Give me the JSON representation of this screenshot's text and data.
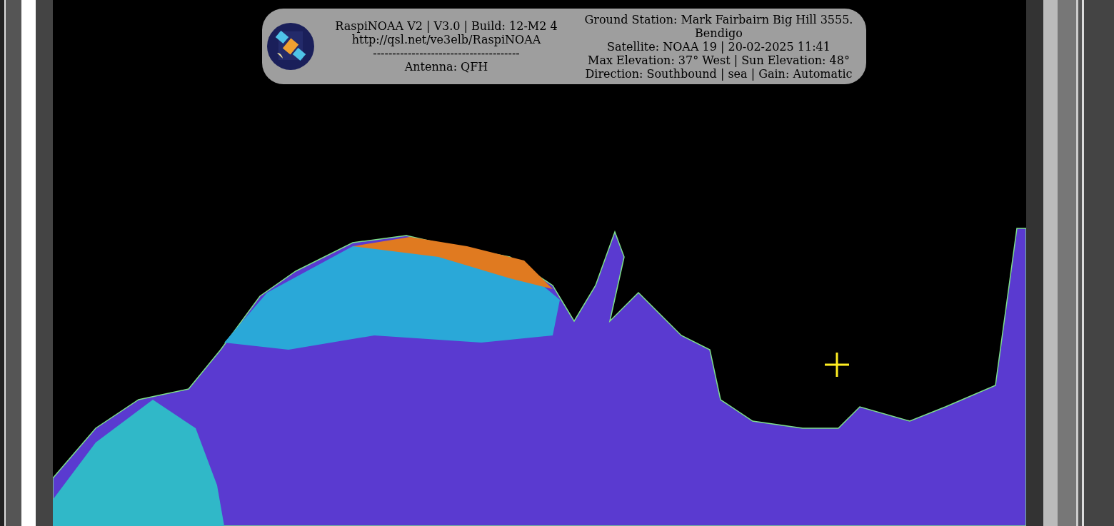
{
  "header": {
    "left_lines": [
      "RaspiNOAA V2 | V3.0 | Build: 12-M2 4",
      "http://qsl.net/ve3elb/RaspiNOAA",
      "--------------------------------------",
      "Antenna: QFH"
    ],
    "right_lines": [
      "Ground Station: Mark Fairbairn Big Hill 3555.",
      "Bendigo",
      "Satellite: NOAA 19 | 20-02-2025 11:41",
      "Max Elevation: 37° West | Sun Elevation: 48°",
      "Direction: Southbound | sea | Gain: Automatic"
    ]
  }
}
